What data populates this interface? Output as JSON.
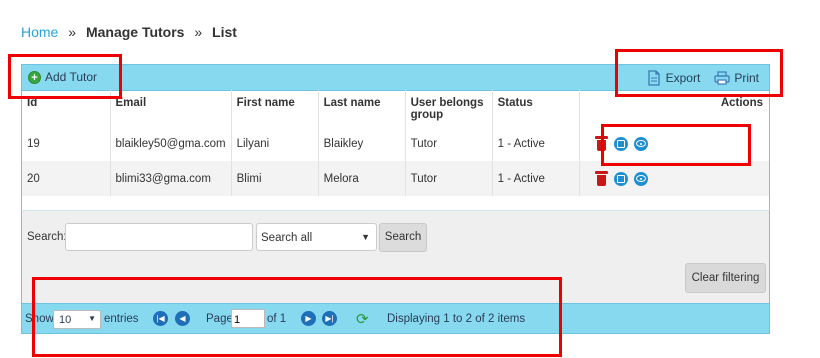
{
  "breadcrumb": {
    "home": "Home",
    "sep": "»",
    "section": "Manage Tutors",
    "page": "List"
  },
  "toolbar": {
    "add_label": "Add Tutor",
    "export_label": "Export",
    "print_label": "Print"
  },
  "table": {
    "headers": [
      "Id",
      "Email",
      "First name",
      "Last name",
      "User belongs group",
      "Status",
      "Actions"
    ],
    "rows": [
      {
        "id": "19",
        "email": "blaikley50@gma.com",
        "first": "Lilyani",
        "last": "Blaikley",
        "group": "Tutor",
        "status": "1 - Active"
      },
      {
        "id": "20",
        "email": "blimi33@gma.com",
        "first": "Blimi",
        "last": "Melora",
        "group": "Tutor",
        "status": "1 - Active"
      }
    ]
  },
  "filter": {
    "search_label": "Search:",
    "search_value": "",
    "scope_value": "Search all",
    "search_button": "Search",
    "clear_button": "Clear filtering"
  },
  "pager": {
    "show_label": "Show",
    "page_size": "10",
    "entries_label": "entries",
    "page_label": "Page",
    "page_value": "1",
    "of_label": "of 1",
    "display_text": "Displaying 1 to 2 of 2 items"
  },
  "colors": {
    "bar": "#87d9f0",
    "accent": "#29a3d6",
    "highlight": "#ee0000",
    "delete": "#c81818"
  }
}
